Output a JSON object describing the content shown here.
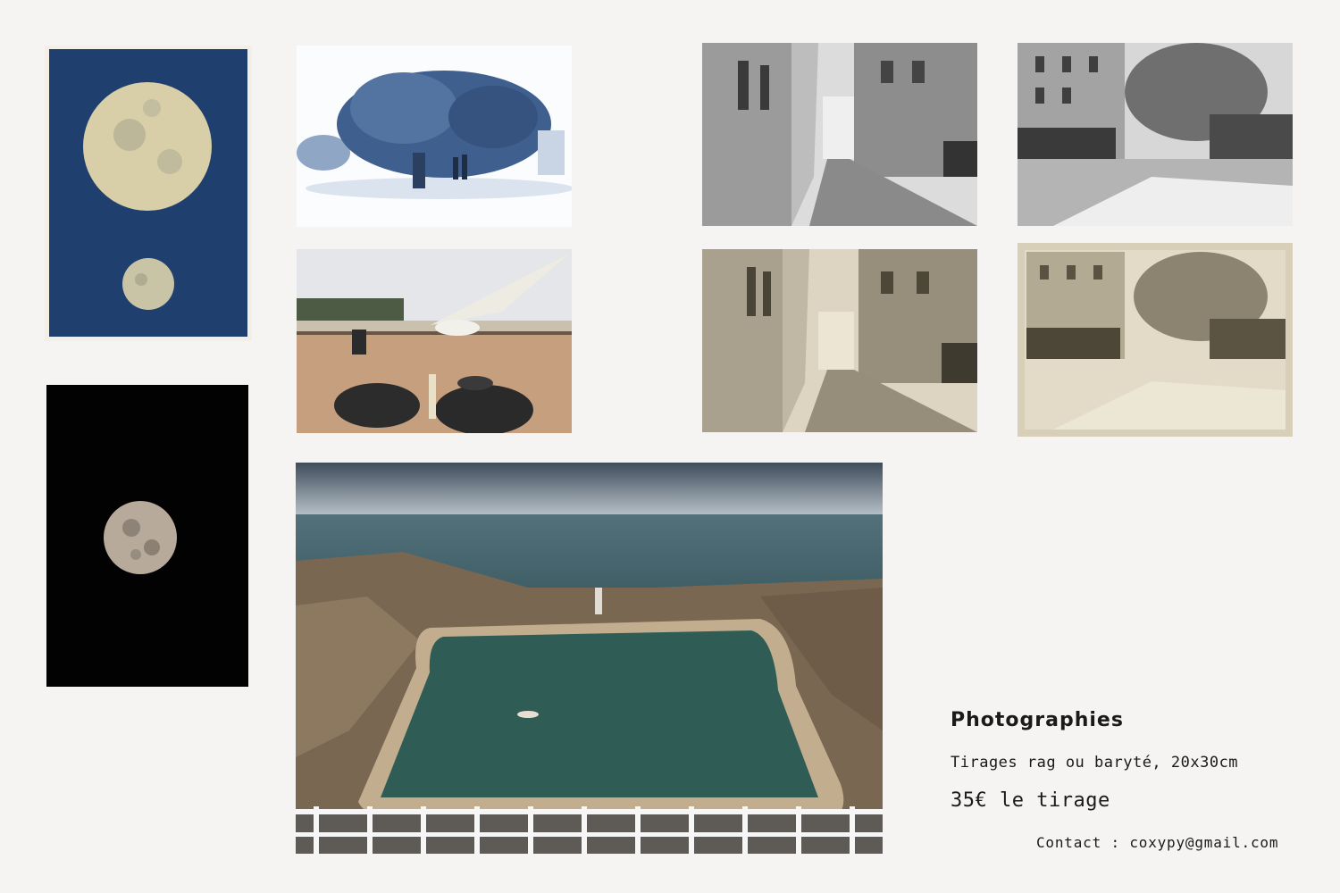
{
  "photos": [
    {
      "name": "cyanotype-two-moons",
      "subject": "moon"
    },
    {
      "name": "blue-tree",
      "subject": "tree"
    },
    {
      "name": "street-bw-1",
      "subject": "street"
    },
    {
      "name": "square-bw-1",
      "subject": "square"
    },
    {
      "name": "black-moon",
      "subject": "moon"
    },
    {
      "name": "seagull-beach",
      "subject": "seagull"
    },
    {
      "name": "street-sepia",
      "subject": "street"
    },
    {
      "name": "square-sepia",
      "subject": "square"
    },
    {
      "name": "sea-pool",
      "subject": "pool"
    }
  ],
  "info": {
    "title": "Photographies",
    "subtitle": "Tirages rag ou baryté, 20x30cm",
    "price": "35€ le tirage",
    "contact": "Contact : coxypy@gmail.com"
  }
}
